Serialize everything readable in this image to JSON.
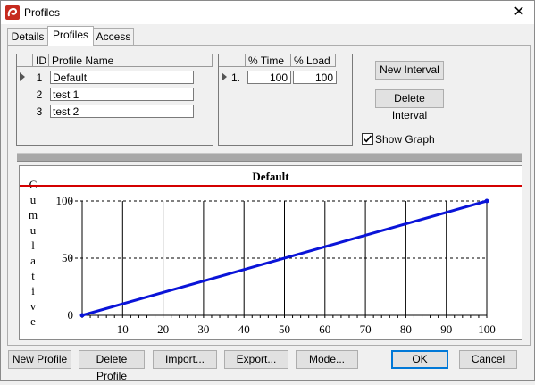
{
  "window": {
    "title": "Profiles",
    "close_glyph": "✕",
    "icon": "profiles-app-icon"
  },
  "tabs": [
    {
      "label": "Details",
      "active": false
    },
    {
      "label": "Profiles",
      "active": true
    },
    {
      "label": "Access",
      "active": false
    }
  ],
  "profiles_grid": {
    "columns": [
      "ID",
      "Profile Name"
    ],
    "rows": [
      {
        "id": "1",
        "name": "Default",
        "selected": true
      },
      {
        "id": "2",
        "name": "test 1",
        "selected": false
      },
      {
        "id": "3",
        "name": "test 2",
        "selected": false
      }
    ]
  },
  "interval_grid": {
    "columns": [
      "% Time",
      "% Load"
    ],
    "rows": [
      {
        "index": "1.",
        "time": "100",
        "load": "100",
        "selected": true
      }
    ]
  },
  "buttons": {
    "new_interval": "New Interval",
    "delete_interval": "Delete Interval",
    "new_profile": "New Profile",
    "delete_profile": "Delete Profile",
    "import": "Import...",
    "export": "Export...",
    "mode": "Mode...",
    "ok": "OK",
    "cancel": "Cancel"
  },
  "show_graph": {
    "label": "Show Graph",
    "checked": true
  },
  "chart_data": {
    "type": "line",
    "title": "Default",
    "ylabel": "Cumulative",
    "x": [
      0,
      100
    ],
    "y": [
      0,
      100
    ],
    "xlim": [
      0,
      100
    ],
    "ylim": [
      0,
      100
    ],
    "x_ticks": [
      "10",
      "20",
      "30",
      "40",
      "50",
      "60",
      "70",
      "80",
      "90",
      "100"
    ],
    "y_ticks": [
      "100",
      "50",
      "0"
    ],
    "grid": true,
    "colors": {
      "line": "#0a14d8",
      "title_rule": "#d40000"
    }
  }
}
